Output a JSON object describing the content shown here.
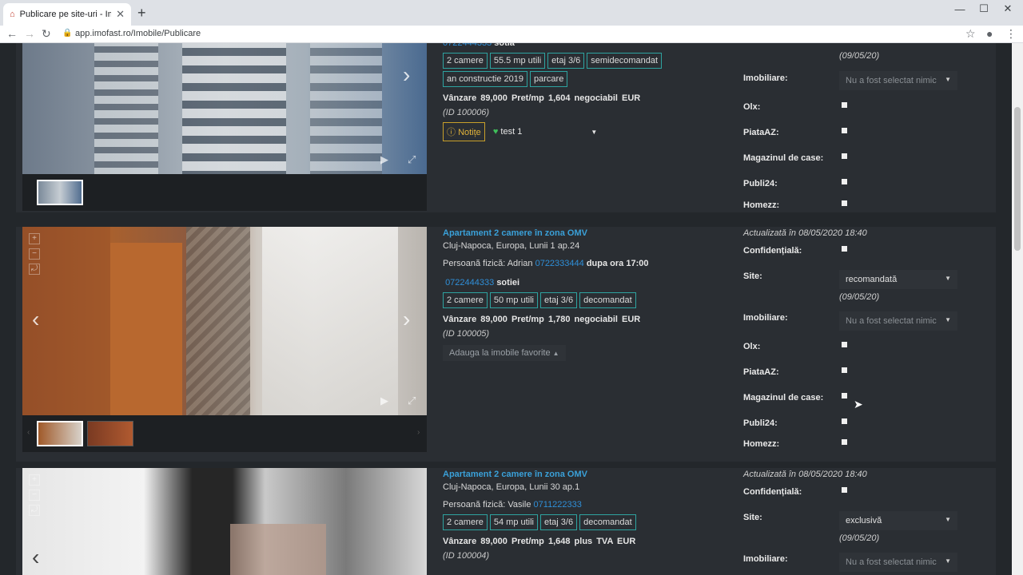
{
  "browser": {
    "tab_title": "Publicare pe site-uri - ImoFast",
    "url": "app.imofast.ro/Imobile/Publicare"
  },
  "listings": [
    {
      "phone_label": "sotia",
      "tags": [
        "2 camere",
        "55.5 mp utili",
        "etaj 3/6",
        "semidecomandat",
        "an constructie 2019",
        "parcare"
      ],
      "price": "Vânzare 89,000   Pret/mp 1,604   negociabil  EUR",
      "id": "(ID 100006)",
      "notes_label": "Notițe",
      "favorite_label": "test 1",
      "site_date": "(09/05/20)",
      "imobiliare_value": "Nu a fost selectat nimic"
    },
    {
      "title": "Apartament 2 camere în zona OMV",
      "address": "Cluj-Napoca, Europa, Lunii 1 ap.24",
      "owner_prefix": "Persoană fizică: Adrian",
      "phone1": "0722333444",
      "phone1_note": "dupa ora 17:00",
      "phone2": "0722444333",
      "phone2_note": "sotiei",
      "tags": [
        "2 camere",
        "50 mp utili",
        "etaj 3/6",
        "decomandat"
      ],
      "price": "Vânzare 89,000   Pret/mp 1,780   negociabil  EUR",
      "id": "(ID 100005)",
      "favorite_add_label": "Adauga la imobile favorite",
      "updated": "Actualizată în 08/05/2020 18:40",
      "site_value": "recomandată",
      "site_date": "(09/05/20)",
      "imobiliare_value": "Nu a fost selectat nimic"
    },
    {
      "title": "Apartament 2 camere în zona OMV",
      "address": "Cluj-Napoca, Europa, Lunii 30 ap.1",
      "owner_prefix": "Persoană fizică: Vasile",
      "phone1": "0711222333",
      "tags": [
        "2 camere",
        "54 mp utili",
        "etaj 3/6",
        "decomandat"
      ],
      "price": "Vânzare 89,000   Pret/mp 1,648   plus TVA  EUR",
      "id": "(ID 100004)",
      "updated": "Actualizată în 08/05/2020 18:40",
      "site_value": "exclusivă",
      "site_date": "(09/05/20)",
      "imobiliare_value": "Nu a fost selectat nimic"
    }
  ],
  "labels": {
    "confidentiala": "Confidențială:",
    "site": "Site:",
    "imobiliare": "Imobiliare:",
    "olx": "Olx:",
    "piataaz": "PiataAZ:",
    "magazinul": "Magazinul de case:",
    "publi24": "Publi24:",
    "homezz": "Homezz:"
  }
}
